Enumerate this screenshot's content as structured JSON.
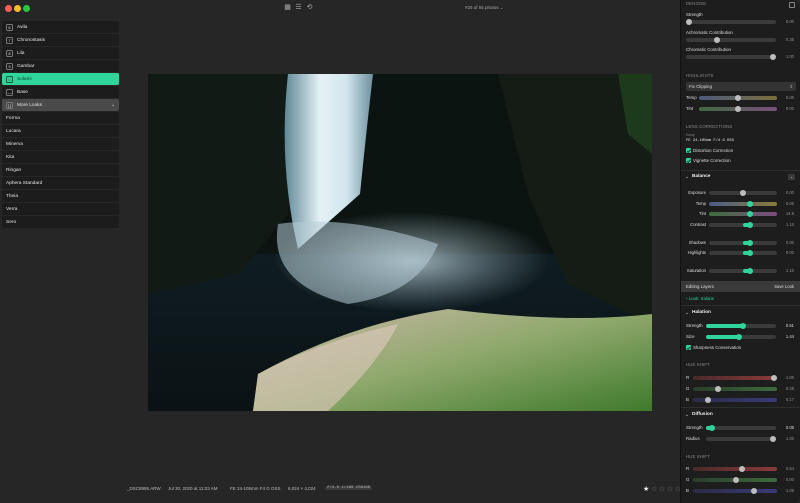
{
  "toolbar": {
    "counter": "#25 of 55 photos"
  },
  "sidebar": {
    "looks": [
      {
        "num": "6",
        "label": "Avila"
      },
      {
        "num": "7",
        "label": "Chronostasis"
      },
      {
        "num": "8",
        "label": "Lila"
      },
      {
        "num": "9",
        "label": "Gambar"
      },
      {
        "num": "0",
        "label": "Solaris",
        "active": true
      },
      {
        "num": "—",
        "label": "Base"
      },
      {
        "num": "[ ]",
        "label": "More Looks",
        "more": true
      },
      {
        "label": "Forma"
      },
      {
        "label": "Lucara"
      },
      {
        "label": "Minerva"
      },
      {
        "label": "Kita"
      },
      {
        "label": "Ringan"
      },
      {
        "label": "Aphera Standard"
      },
      {
        "label": "Theia"
      },
      {
        "label": "Verra"
      },
      {
        "label": "Sero"
      }
    ]
  },
  "status": {
    "filename": "_DSC8995.ARW",
    "date": "Jul 30, 2020 at 11:03 AM",
    "lens": "FE 24-105mm F4 G OSS",
    "dims": "6,024 × 4,024",
    "exposure": "f/4.0 1/160 ISO100"
  },
  "panel": {
    "denoise": {
      "header": "DENOISE",
      "strength_label": "Strength",
      "strength_value": "0.00",
      "achro_label": "Achromatic Contribution",
      "achro_value": "0.35",
      "chroma_label": "Chromatic Contribution",
      "chroma_value": "1.00"
    },
    "highlights": {
      "header": "HIGHLIGHTS",
      "mode": "Fix Clipping",
      "temp_label": "Temp",
      "temp_value": "0.00",
      "tint_label": "Tint",
      "tint_value": "0.00"
    },
    "lens": {
      "header": "LENS CORRECTIONS",
      "maker": "Sony",
      "model": "FE 24-105mm F/4 G OSS",
      "distortion": "Distortion Correction",
      "vignette": "Vignette Correction"
    },
    "balance": {
      "title": "Balance",
      "rows": [
        {
          "label": "Exposure",
          "value": "0.00",
          "pos": 0.5
        },
        {
          "label": "Temp",
          "value": "0.06",
          "pos": 0.6,
          "kind": "temp"
        },
        {
          "label": "Tint",
          "value": "14.9",
          "pos": 0.6,
          "kind": "tint"
        },
        {
          "label": "Contrast",
          "value": "1.15",
          "pos": 0.6
        },
        {
          "label": "Shadows",
          "value": "0.00",
          "pos": 0.6
        },
        {
          "label": "Highlights",
          "value": "0.00",
          "pos": 0.6
        },
        {
          "label": "Saturation",
          "value": "1.10",
          "pos": 0.6
        }
      ]
    },
    "editing": {
      "label": "Editing Layers",
      "save": "Save Look",
      "look": "Look: Solaris"
    },
    "halation": {
      "title": "Halation",
      "strength_label": "Strength",
      "strength_value": "0.51",
      "size_label": "Size",
      "size_value": "1.44",
      "sharp": "Sharpness Conservation",
      "hue_header": "HUE SHIFT",
      "r": "R",
      "g": "G",
      "b": "B",
      "r_value": "1.00",
      "g_value": "0.28",
      "b_value": "0.17"
    },
    "diffusion": {
      "title": "Diffusion",
      "strength_label": "Strength",
      "strength_value": "0.05",
      "radius_label": "Radius",
      "radius_value": "1.00",
      "hue_header": "HUE SHIFT",
      "r": "R",
      "g": "G",
      "b": "B",
      "r_value": "0.64",
      "g_value": "0.00",
      "b_value": "1.06"
    }
  },
  "colors": {
    "accent": "#2fd59a",
    "panel_bg": "#1d1d1d",
    "app_bg": "#262626"
  }
}
